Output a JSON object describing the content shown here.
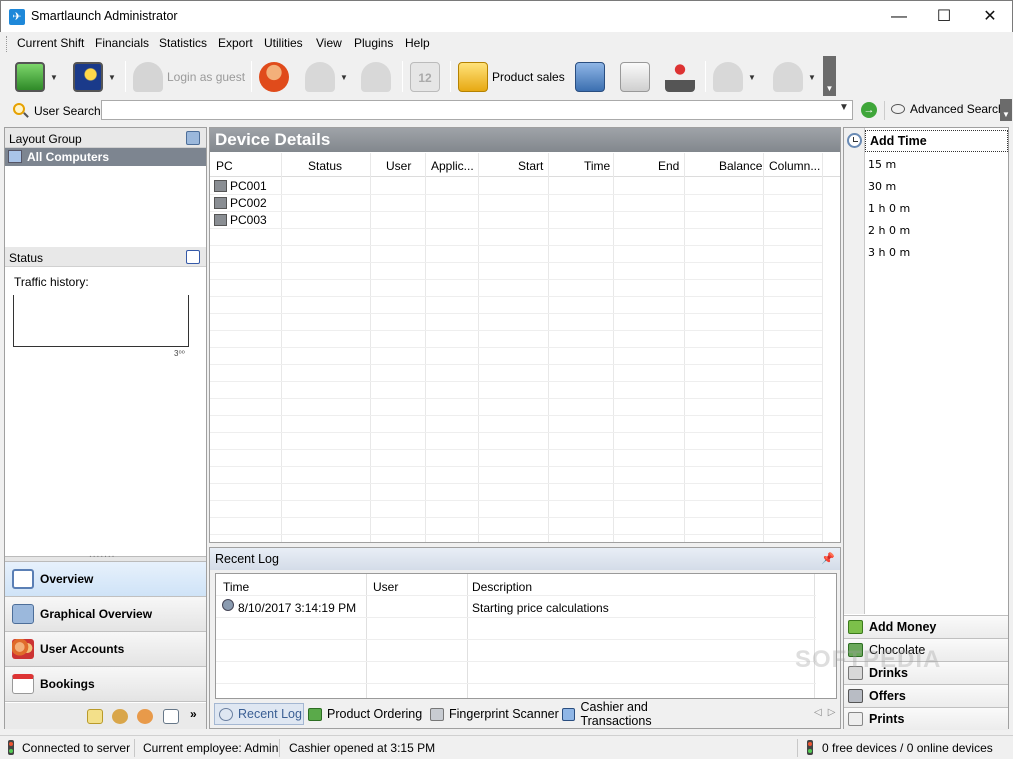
{
  "window": {
    "title": "Smartlaunch Administrator",
    "minimize": "—",
    "maximize": "☐",
    "close": "✕"
  },
  "menu": [
    "Current Shift",
    "Financials",
    "Statistics",
    "Export",
    "Utilities",
    "View",
    "Plugins",
    "Help"
  ],
  "toolbar": {
    "login_guest": "Login as guest",
    "product_sales": "Product sales",
    "calendar_num": "12"
  },
  "search": {
    "label": "User Search:",
    "value": "",
    "advanced": "Advanced Search"
  },
  "left": {
    "layout_group": "Layout Group",
    "all_computers": "All Computers",
    "status": "Status",
    "traffic_history": "Traffic history:",
    "traffic_scale": "3⁰⁰",
    "nav": [
      "Overview",
      "Graphical Overview",
      "User Accounts",
      "Bookings"
    ],
    "active_nav": "Overview",
    "more": "»"
  },
  "device": {
    "title": "Device Details",
    "columns": [
      "PC",
      "Status",
      "User",
      "Applic...",
      "Start",
      "Time",
      "End",
      "Balance",
      "Column..."
    ],
    "rows": [
      "PC001",
      "PC002",
      "PC003"
    ]
  },
  "log": {
    "title": "Recent Log",
    "columns": [
      "Time",
      "User",
      "Description"
    ],
    "rows": [
      {
        "time": "8/10/2017 3:14:19 PM",
        "user": "",
        "description": "Starting price calculations"
      }
    ],
    "tabs": [
      "Recent Log",
      "Product Ordering",
      "Fingerprint Scanner",
      "Cashier and Transactions"
    ],
    "active_tab": "Recent Log"
  },
  "right": {
    "add_time": "Add Time",
    "time_options": [
      "15 m",
      "30 m",
      "1 h 0 m",
      "2 h 0 m",
      "3 h 0 m"
    ],
    "buttons": [
      "Add Money",
      "Chocolate",
      "Drinks",
      "Offers",
      "Prints"
    ]
  },
  "watermark": "SOFTPEDIA",
  "statusbar": {
    "connected": "Connected to server",
    "employee": "Current employee: Admin",
    "cashier": "Cashier opened at 3:15 PM",
    "devices": "0 free devices / 0 online devices"
  }
}
